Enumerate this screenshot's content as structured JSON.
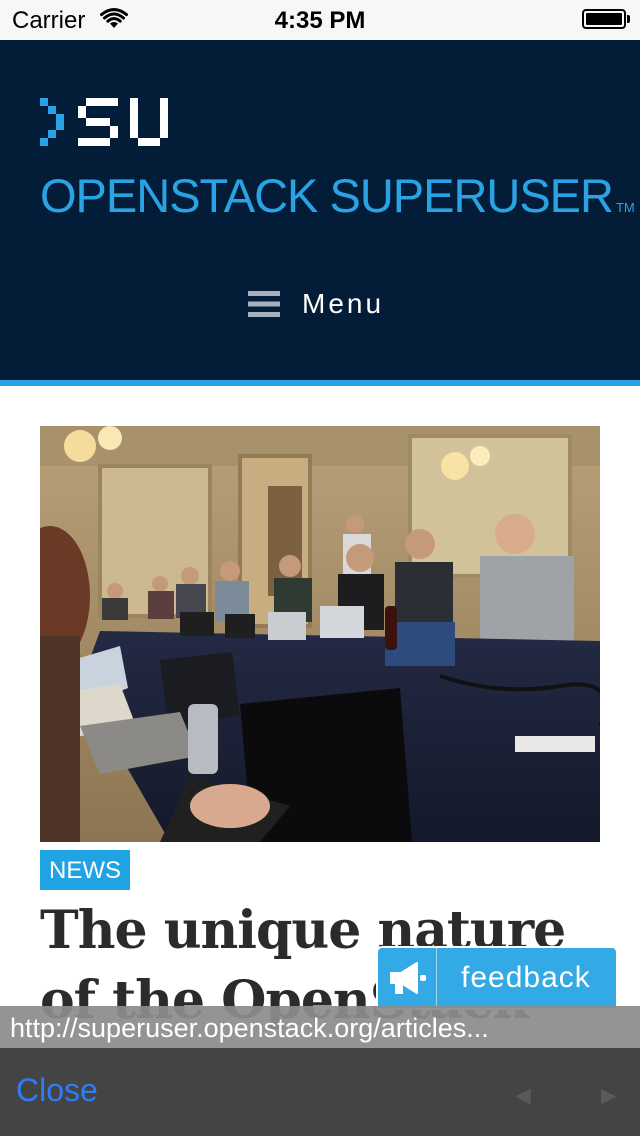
{
  "status_bar": {
    "carrier": "Carrier",
    "time": "4:35 PM",
    "wifi_icon": "wifi-icon",
    "battery_icon": "battery-icon"
  },
  "header": {
    "logo_icon": "su-logo-icon",
    "site_name": "OPENSTACK SUPERUSER",
    "trademark": "TM",
    "menu_icon": "hamburger-icon",
    "menu_label": "Menu",
    "background_color": "#031d38",
    "accent_color": "#29a3e3"
  },
  "article": {
    "category": "NEWS",
    "title": "The unique nature of the OpenStack",
    "image": "photo of people working on laptops around a long conference table",
    "badge_color": "#1fa3e2"
  },
  "feedback": {
    "icon": "megaphone-icon",
    "label": "feedback"
  },
  "browser": {
    "url": "http://superuser.openstack.org/articles...",
    "close_label": "Close",
    "back_icon": "back-arrow-icon",
    "forward_icon": "forward-arrow-icon"
  }
}
